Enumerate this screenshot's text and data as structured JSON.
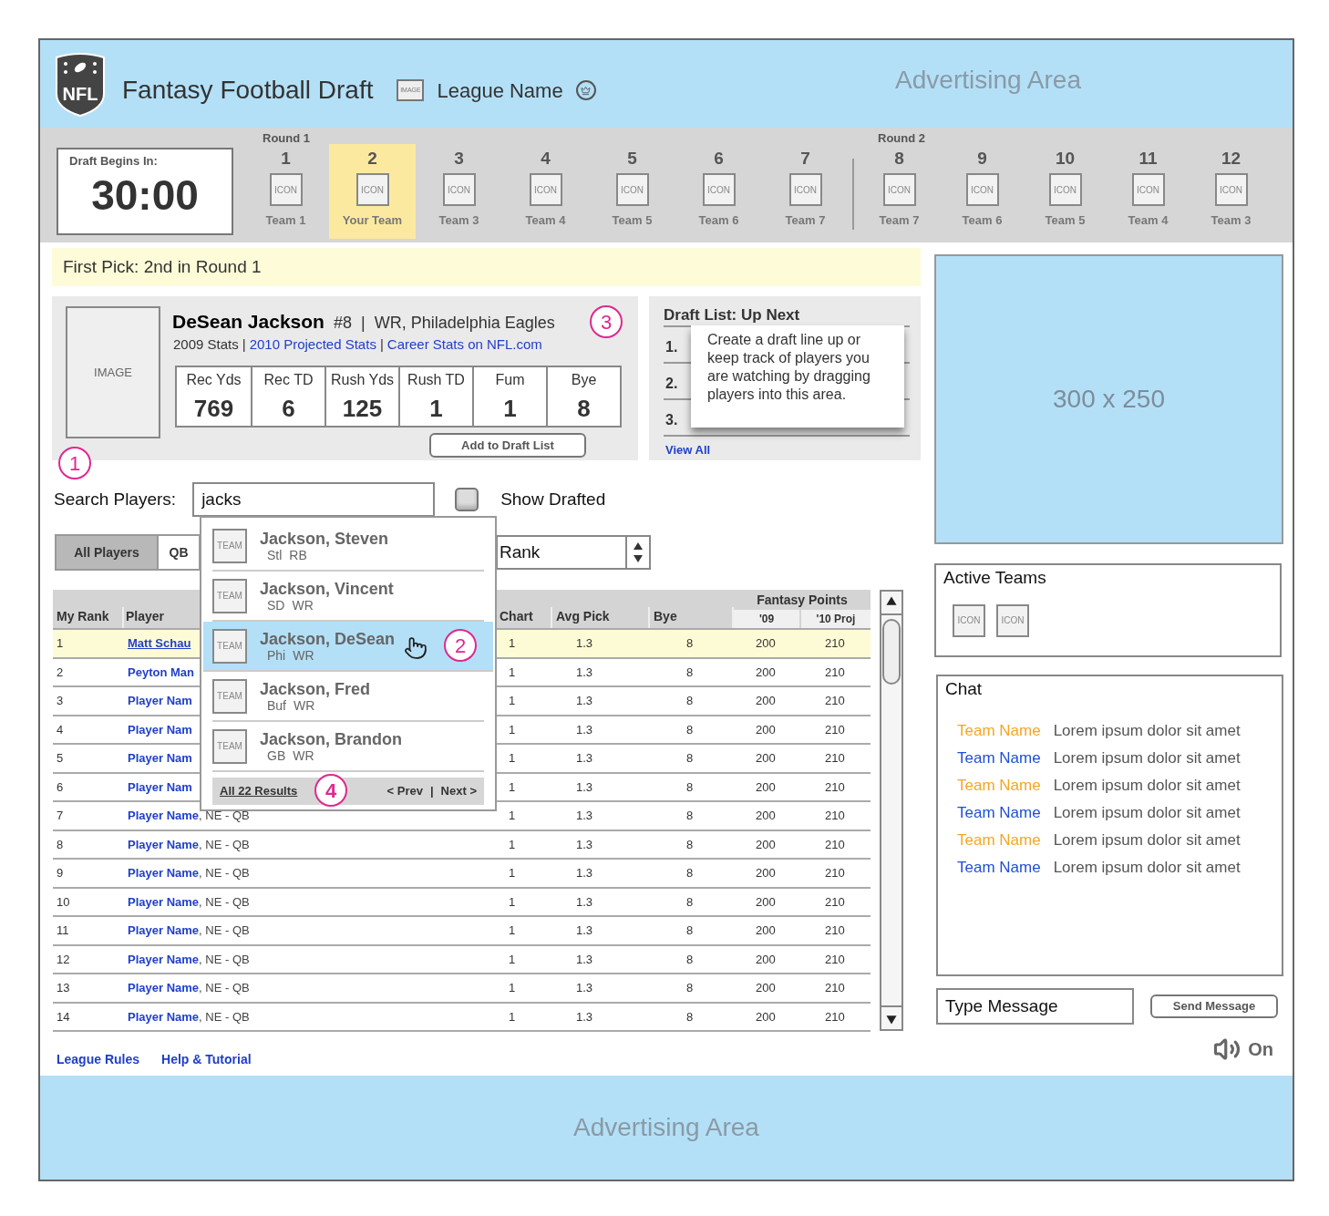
{
  "header": {
    "logo_text": "NFL",
    "title": "Fantasy Football Draft",
    "image_label": "IMAGE",
    "league_name": "League Name",
    "ad": "Advertising Area"
  },
  "draft": {
    "timer_label": "Draft Begins In:",
    "timer": "30:00",
    "rounds": [
      {
        "label": "Round 1",
        "picks": [
          {
            "number": "1",
            "icon": "ICON",
            "team": "Team 1",
            "selected": false
          },
          {
            "number": "2",
            "icon": "ICON",
            "team": "Your Team",
            "selected": true
          },
          {
            "number": "3",
            "icon": "ICON",
            "team": "Team 3",
            "selected": false
          },
          {
            "number": "4",
            "icon": "ICON",
            "team": "Team 4",
            "selected": false
          },
          {
            "number": "5",
            "icon": "ICON",
            "team": "Team 5",
            "selected": false
          },
          {
            "number": "6",
            "icon": "ICON",
            "team": "Team 6",
            "selected": false
          },
          {
            "number": "7",
            "icon": "ICON",
            "team": "Team 7",
            "selected": false
          }
        ]
      },
      {
        "label": "Round 2",
        "picks": [
          {
            "number": "8",
            "icon": "ICON",
            "team": "Team 7",
            "selected": false
          },
          {
            "number": "9",
            "icon": "ICON",
            "team": "Team 6",
            "selected": false
          },
          {
            "number": "10",
            "icon": "ICON",
            "team": "Team 5",
            "selected": false
          },
          {
            "number": "11",
            "icon": "ICON",
            "team": "Team 4",
            "selected": false
          },
          {
            "number": "12",
            "icon": "ICON",
            "team": "Team 3",
            "selected": false
          }
        ]
      }
    ]
  },
  "first_pick": "First Pick: 2nd in Round 1",
  "player_card": {
    "image_label": "IMAGE",
    "name": "DeSean Jackson",
    "number": "#8",
    "separator": "|",
    "position": "WR, Philadelphia Eagles",
    "stats_label": "2009 Stats",
    "links": [
      "2010 Projected Stats",
      "Career Stats on NFL.com"
    ],
    "link_separator": "|",
    "stats": [
      {
        "label": "Rec Yds",
        "value": "769"
      },
      {
        "label": "Rec TD",
        "value": "6"
      },
      {
        "label": "Rush Yds",
        "value": "125"
      },
      {
        "label": "Rush TD",
        "value": "1"
      },
      {
        "label": "Fum",
        "value": "1"
      },
      {
        "label": "Bye",
        "value": "8"
      }
    ],
    "add_button": "Add to Draft List"
  },
  "draft_list": {
    "title": "Draft List: Up Next",
    "slots": [
      "1.",
      "2.",
      "3."
    ],
    "tooltip": "Create a draft line up or keep track of  players you are watching by dragging players into this area.",
    "view_all": "View All"
  },
  "annotations": [
    "1",
    "2",
    "3",
    "4"
  ],
  "search": {
    "label": "Search Players:",
    "value": "jacks",
    "show_drafted": {
      "label": "Show Drafted",
      "checked": false
    }
  },
  "search_results": {
    "items": [
      {
        "icon": "TEAM",
        "name": "Jackson, Steven",
        "team": "Stl",
        "pos": "RB",
        "selected": false
      },
      {
        "icon": "TEAM",
        "name": "Jackson, Vincent",
        "team": "SD",
        "pos": "WR",
        "selected": false
      },
      {
        "icon": "TEAM",
        "name": "Jackson, DeSean",
        "team": "Phi",
        "pos": "WR",
        "selected": true
      },
      {
        "icon": "TEAM",
        "name": "Jackson, Fred",
        "team": "Buf",
        "pos": "WR",
        "selected": false
      },
      {
        "icon": "TEAM",
        "name": "Jackson, Brandon",
        "team": "GB",
        "pos": "WR",
        "selected": false
      }
    ],
    "all_results": "All 22 Results",
    "prev": "< Prev",
    "separator": "|",
    "next": "Next >"
  },
  "position_tabs": [
    {
      "label": "All Players",
      "selected": true
    },
    {
      "label": "QB",
      "selected": false
    }
  ],
  "sort_select": {
    "value": "Rank"
  },
  "table": {
    "columns": {
      "rank": "My Rank",
      "player": "Player",
      "chart": "Chart",
      "avg_pick": "Avg Pick",
      "bye": "Bye",
      "fantasy_points": "Fantasy Points",
      "pts_09": "'09",
      "pts_10": "'10 Proj"
    },
    "rows": [
      {
        "rank": "1",
        "player": "Matt Schau",
        "chart": "1",
        "avg_pick": "1.3",
        "bye": "8",
        "pts_09": "200",
        "pts_10": "210",
        "selected": true
      },
      {
        "rank": "2",
        "player": "Peyton Man",
        "chart": "1",
        "avg_pick": "1.3",
        "bye": "8",
        "pts_09": "200",
        "pts_10": "210",
        "selected": false
      },
      {
        "rank": "3",
        "player": "Player Nam",
        "chart": "1",
        "avg_pick": "1.3",
        "bye": "8",
        "pts_09": "200",
        "pts_10": "210",
        "selected": false
      },
      {
        "rank": "4",
        "player": "Player Nam",
        "chart": "1",
        "avg_pick": "1.3",
        "bye": "8",
        "pts_09": "200",
        "pts_10": "210",
        "selected": false
      },
      {
        "rank": "5",
        "player": "Player Nam",
        "chart": "1",
        "avg_pick": "1.3",
        "bye": "8",
        "pts_09": "200",
        "pts_10": "210",
        "selected": false
      },
      {
        "rank": "6",
        "player": "Player Nam",
        "chart": "1",
        "avg_pick": "1.3",
        "bye": "8",
        "pts_09": "200",
        "pts_10": "210",
        "selected": false
      },
      {
        "rank": "7",
        "player": "Player Name",
        "team_pos": ", NE - QB",
        "chart": "1",
        "avg_pick": "1.3",
        "bye": "8",
        "pts_09": "200",
        "pts_10": "210",
        "selected": false
      },
      {
        "rank": "8",
        "player": "Player Name",
        "team_pos": ", NE - QB",
        "chart": "1",
        "avg_pick": "1.3",
        "bye": "8",
        "pts_09": "200",
        "pts_10": "210",
        "selected": false
      },
      {
        "rank": "9",
        "player": "Player Name",
        "team_pos": ", NE - QB",
        "chart": "1",
        "avg_pick": "1.3",
        "bye": "8",
        "pts_09": "200",
        "pts_10": "210",
        "selected": false
      },
      {
        "rank": "10",
        "player": "Player Name",
        "team_pos": ", NE - QB",
        "chart": "1",
        "avg_pick": "1.3",
        "bye": "8",
        "pts_09": "200",
        "pts_10": "210",
        "selected": false
      },
      {
        "rank": "11",
        "player": "Player Name",
        "team_pos": ", NE - QB",
        "chart": "1",
        "avg_pick": "1.3",
        "bye": "8",
        "pts_09": "200",
        "pts_10": "210",
        "selected": false
      },
      {
        "rank": "12",
        "player": "Player Name",
        "team_pos": ", NE - QB",
        "chart": "1",
        "avg_pick": "1.3",
        "bye": "8",
        "pts_09": "200",
        "pts_10": "210",
        "selected": false
      },
      {
        "rank": "13",
        "player": "Player Name",
        "team_pos": ", NE - QB",
        "chart": "1",
        "avg_pick": "1.3",
        "bye": "8",
        "pts_09": "200",
        "pts_10": "210",
        "selected": false
      },
      {
        "rank": "14",
        "player": "Player Name",
        "team_pos": ", NE - QB",
        "chart": "1",
        "avg_pick": "1.3",
        "bye": "8",
        "pts_09": "200",
        "pts_10": "210",
        "selected": false
      }
    ]
  },
  "footer_links": [
    "League Rules",
    "Help & Tutorial"
  ],
  "ad_box": "300 x 250",
  "active_teams": {
    "title": "Active Teams",
    "icons": [
      "ICON",
      "ICON"
    ]
  },
  "chat": {
    "title": "Chat",
    "messages": [
      {
        "team": "Team Name",
        "color": "#f5a623",
        "text": "Lorem ipsum dolor sit amet"
      },
      {
        "team": "Team Name",
        "color": "#1f4fd8",
        "text": "Lorem ipsum dolor sit amet"
      },
      {
        "team": "Team Name",
        "color": "#f5a623",
        "text": "Lorem ipsum dolor sit amet"
      },
      {
        "team": "Team Name",
        "color": "#1f4fd8",
        "text": "Lorem ipsum dolor sit amet"
      },
      {
        "team": "Team Name",
        "color": "#f5a623",
        "text": "Lorem ipsum dolor sit amet"
      },
      {
        "team": "Team Name",
        "color": "#1f4fd8",
        "text": "Lorem ipsum dolor sit amet"
      }
    ],
    "input_placeholder": "Type Message",
    "send_button": "Send Message"
  },
  "sound": {
    "label": "On",
    "on": true
  },
  "bottom_ad": "Advertising Area"
}
